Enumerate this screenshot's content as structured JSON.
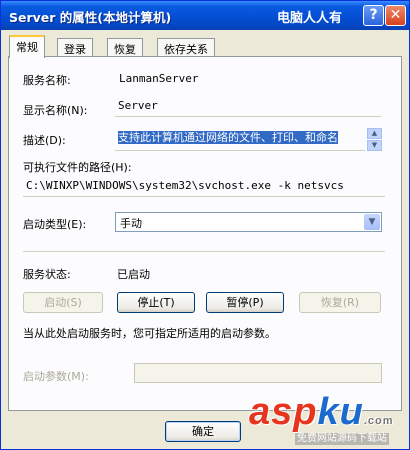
{
  "window": {
    "title": "Server 的属性(本地计算机)",
    "watermark_top": "电脑人人有",
    "help_glyph": "?",
    "close_glyph": "✕"
  },
  "tabs": [
    {
      "label": "常规",
      "active": true
    },
    {
      "label": "登录",
      "active": false
    },
    {
      "label": "恢复",
      "active": false
    },
    {
      "label": "依存关系",
      "active": false
    }
  ],
  "general": {
    "service_name_label": "服务名称:",
    "service_name_value": "LanmanServer",
    "display_name_label": "显示名称(N):",
    "display_name_value": "Server",
    "description_label": "描述(D):",
    "description_value": "支持此计算机通过网络的文件、打印、和命名",
    "path_label": "可执行文件的路径(H):",
    "path_value": "C:\\WINXP\\WINDOWS\\system32\\svchost.exe -k netsvcs",
    "startup_type_label": "启动类型(E):",
    "startup_type_value": "手动",
    "status_label": "服务状态:",
    "status_value": "已启动",
    "buttons": {
      "start": "启动(S)",
      "stop": "停止(T)",
      "pause": "暂停(P)",
      "resume": "恢复(R)"
    },
    "hint": "当从此处启动服务时，您可指定所适用的启动参数。",
    "params_label": "启动参数(M):",
    "params_value": ""
  },
  "footer": {
    "ok": "确定"
  },
  "watermark": {
    "brand_left": "asp",
    "brand_right": "ku",
    "brand_suffix": ".com",
    "tagline": "免费网站源码下载站"
  },
  "colors": {
    "titlebar": "#0550d6",
    "selection": "#316ac5",
    "watermark_red": "#e8331d",
    "watermark_blue": "#1a6ad0"
  }
}
